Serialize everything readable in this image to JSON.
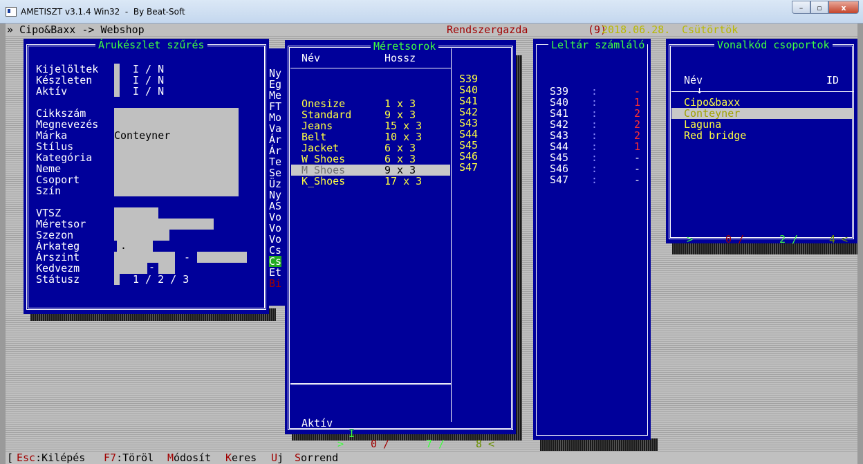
{
  "window": {
    "title": "AMETISZT v3.1.4 Win32  -  By Beat-Soft",
    "min": "–",
    "max": "▫",
    "close": "x"
  },
  "header": {
    "path": "» Cipo&Baxx -> Webshop",
    "user": "Rendszergazda",
    "user_no": "(9)",
    "date": "2018.06.28.",
    "day": "Csütörtök"
  },
  "filter": {
    "title": "Árukészlet szűrés",
    "rows": [
      {
        "label": "Kijelöltek",
        "value": "I / N"
      },
      {
        "label": "Készleten",
        "value": "I / N"
      },
      {
        "label": "Aktív",
        "value": "I / N"
      }
    ],
    "fields": [
      "Cikkszám",
      "Megnevezés",
      "Márka",
      "Stílus",
      "Kategória",
      "Neme",
      "Csoport",
      "Szín"
    ],
    "brand_value": "Conteyner",
    "fields2": [
      "VTSZ",
      "Méretsor",
      "Szezon",
      "Árkateg",
      "Árszint",
      "Kedvezm",
      "Státusz"
    ],
    "status_values": "1 / 2 / 3",
    "dash1": "-",
    "dash2": "-",
    "dot": "."
  },
  "hidden_menu": {
    "letters": [
      "Ny",
      "Eg",
      "Me",
      "FT",
      "Mo",
      "Va",
      "Ár",
      "Ár",
      "Te",
      "Se",
      "Üz",
      "Ny",
      "AS",
      "Vo",
      "Vo",
      "Vo",
      "Cs",
      "Cs",
      "Et",
      "Bi"
    ]
  },
  "sizes": {
    "title": "Méretsorok",
    "col_name": "Név",
    "col_len": "Hossz",
    "rows": [
      {
        "name": "Onesize",
        "len": "1 x 3"
      },
      {
        "name": "Standard",
        "len": "9 x 3"
      },
      {
        "name": "Jeans",
        "len": "15 x 3"
      },
      {
        "name": "Belt",
        "len": "10 x 3"
      },
      {
        "name": "Jacket",
        "len": "6 x 3"
      },
      {
        "name": "W_Shoes",
        "len": "6 x 3"
      },
      {
        "name": "M_Shoes",
        "len": "9 x 3"
      },
      {
        "name": "K_Shoes",
        "len": "17 x 3"
      }
    ],
    "selected_index": 6,
    "codes": [
      "S39",
      "S40",
      "S41",
      "S42",
      "S43",
      "S44",
      "S45",
      "S46",
      "S47"
    ],
    "active_label": "Aktív",
    "active_value": "I",
    "footer": {
      "arrow": ">",
      "a": "0 /",
      "b": "7 /",
      "c": "8 <"
    }
  },
  "counter": {
    "title": "Leltár számláló",
    "rows": [
      {
        "code": "S39",
        "sep": ":",
        "val": "-",
        "color": "red"
      },
      {
        "code": "S40",
        "sep": ":",
        "val": "1",
        "color": "red"
      },
      {
        "code": "S41",
        "sep": ":",
        "val": "2",
        "color": "red"
      },
      {
        "code": "S42",
        "sep": ":",
        "val": "2",
        "color": "red"
      },
      {
        "code": "S43",
        "sep": ":",
        "val": "2",
        "color": "red"
      },
      {
        "code": "S44",
        "sep": ":",
        "val": "1",
        "color": "red"
      },
      {
        "code": "S45",
        "sep": ":",
        "val": "-",
        "color": "white"
      },
      {
        "code": "S46",
        "sep": ":",
        "val": "-",
        "color": "white"
      },
      {
        "code": "S47",
        "sep": ":",
        "val": "-",
        "color": "white"
      }
    ]
  },
  "barcode": {
    "title": "Vonalkód csoportok",
    "col_name": "Név",
    "col_id": "ID",
    "arrow": "↓",
    "rows": [
      "Cipo&baxx",
      "Conteyner",
      "Laguna",
      "Red bridge"
    ],
    "selected_index": 1,
    "footer": {
      "arrow": ">",
      "a": "0 /",
      "b": "2 /",
      "c": "4 <"
    }
  },
  "bottom": {
    "bracket": "[",
    "esc_key": "Esc",
    "esc_label": ":Kilépés",
    "f7_key": "F7",
    "f7_label": ":Töröl",
    "mod_key": "M",
    "mod_label": "ódosít",
    "ker_key": "K",
    "ker_label": "eres",
    "uj_key": "U",
    "uj_label": "j",
    "sor_key": "S",
    "sor_label": "orrend"
  }
}
